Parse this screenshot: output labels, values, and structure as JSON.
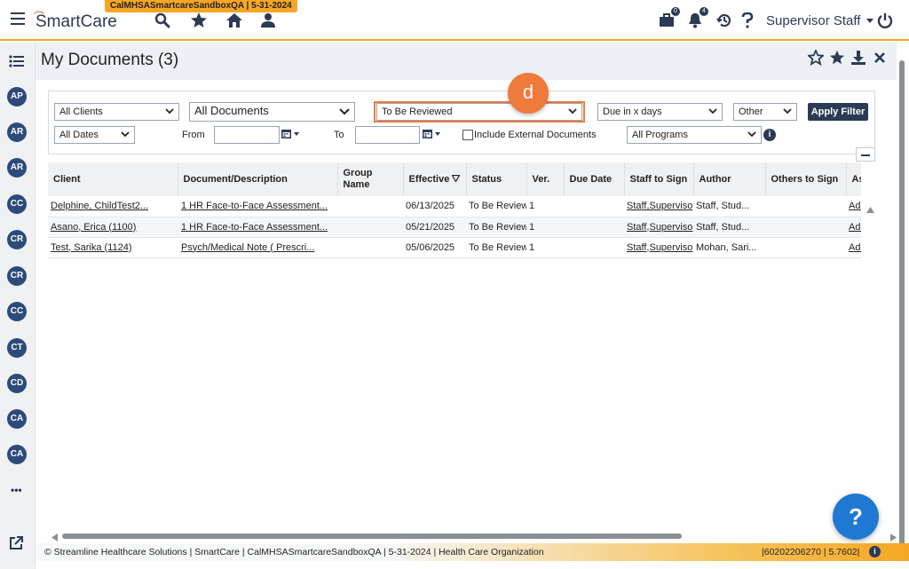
{
  "app": {
    "env_badge": "CalMHSASmartcareSandboxQA | 5-31-2024",
    "logo": "SmartCare",
    "user": "Supervisor Staff",
    "briefcase_count": "0",
    "bell_count": "4"
  },
  "header": {
    "title": "My Documents (3)"
  },
  "rail": {
    "avatars": [
      "AP",
      "AR",
      "AR",
      "CC",
      "CR",
      "CR",
      "CC",
      "CT",
      "CD",
      "CA",
      "CA"
    ],
    "more": "•••"
  },
  "filters": {
    "client": "All Clients",
    "documents": "All Documents",
    "status": "To Be Reviewed",
    "due": "Due in x days",
    "other": "Other",
    "apply": "Apply Filter",
    "dates": "All Dates",
    "from_label": "From",
    "to_label": "To",
    "include_external": "Include External Documents",
    "programs": "All Programs"
  },
  "callout": {
    "label": "d"
  },
  "table": {
    "columns": [
      "Client",
      "Document/Description",
      "Group Name",
      "Effective",
      "Status",
      "Ver.",
      "Due Date",
      "Staff to Sign",
      "Author",
      "Others to Sign",
      "As"
    ],
    "rows": [
      [
        "Delphine, ChildTest2...",
        "1 HR Face-to-Face Assessment...",
        "",
        "06/13/2025",
        "To Be Review",
        "1",
        "",
        "Staff,Superviso",
        "Staff, Stud...",
        "",
        "Add"
      ],
      [
        "Asano, Erica (1100)",
        "1 HR Face-to-Face Assessment...",
        "",
        "05/21/2025",
        "To Be Review",
        "1",
        "",
        "Staff,Superviso",
        "Staff, Stud...",
        "",
        "Add"
      ],
      [
        "Test, Sarika (1124)",
        "Psych/Medical Note ( Prescri...",
        "",
        "05/06/2025",
        "To Be Review",
        "1",
        "",
        "Staff,Superviso",
        "Mohan, Sari...",
        "",
        "Add"
      ]
    ]
  },
  "footer": {
    "left": "© Streamline Healthcare Solutions | SmartCare | CalMHSASmartcareSandboxQA | 5-31-2024 | ",
    "org": "Health Care Organization",
    "right": "|60202206270 | 5.7602|"
  },
  "help": {
    "label": "?"
  }
}
